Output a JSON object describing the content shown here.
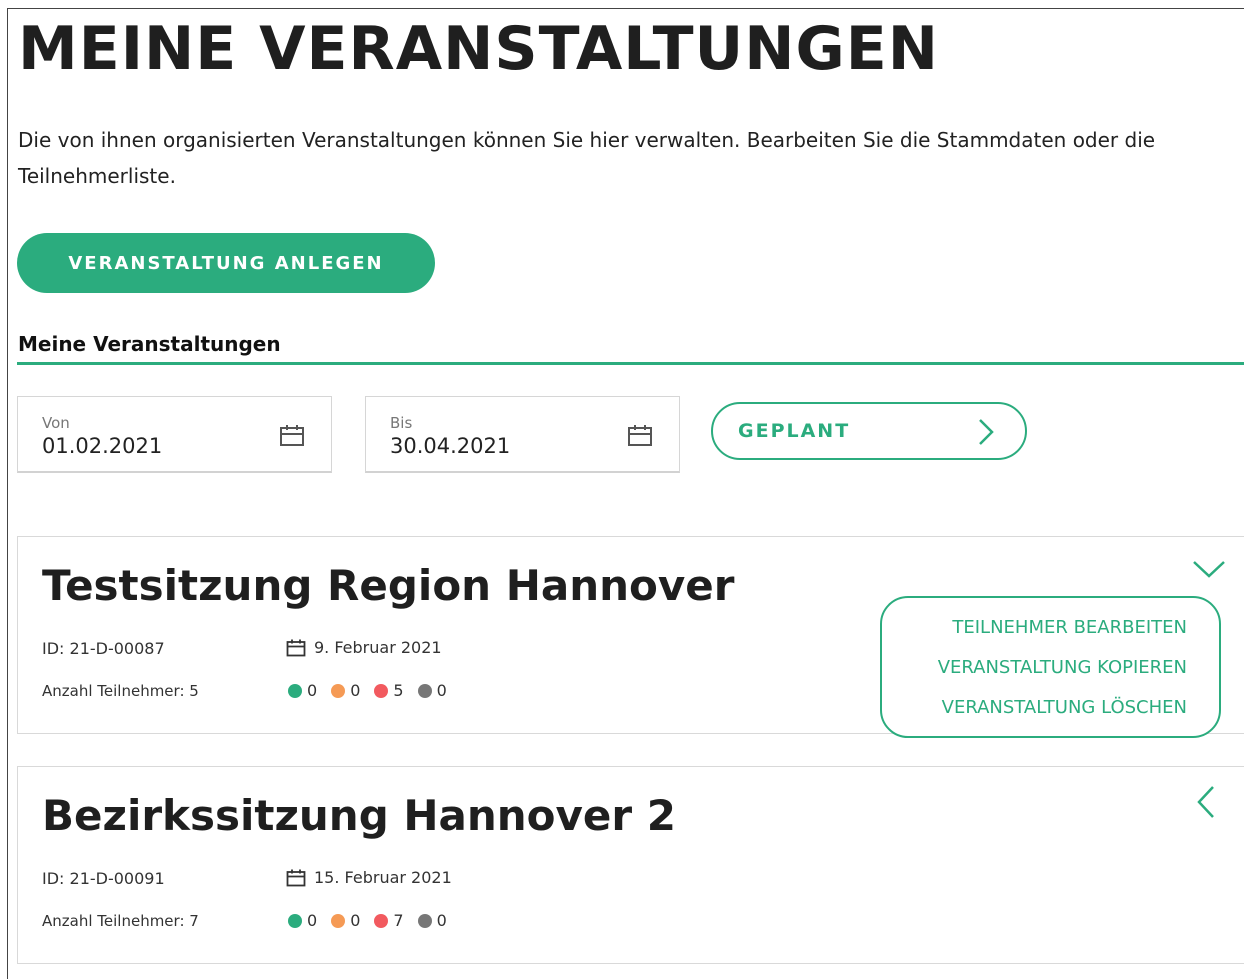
{
  "page": {
    "title": "MEINE VERANSTALTUNGEN",
    "intro": "Die von ihnen organisierten Veranstaltungen können Sie hier verwalten. Bearbeiten Sie die Stammdaten oder die Teilnehmerliste."
  },
  "create_button_label": "VERANSTALTUNG ANLEGEN",
  "list": {
    "heading": "Meine Veranstaltungen"
  },
  "filters": {
    "from": {
      "label": "Von",
      "value": "01.02.2021"
    },
    "to": {
      "label": "Bis",
      "value": "30.04.2021"
    },
    "status_label": "GEPLANT"
  },
  "status_colors": {
    "green": "#2bac7e",
    "orange": "#f59a55",
    "red": "#f25a5f",
    "grey": "#777777"
  },
  "events": [
    {
      "title": "Testsitzung Region Hannover",
      "id_text": "ID: 21-D-00087",
      "date": "9. Februar 2021",
      "participants_text": "Anzahl Teilnehmer: 5",
      "counts": {
        "green": "0",
        "orange": "0",
        "red": "5",
        "grey": "0"
      },
      "toggle_icon": "chevron-down-icon"
    },
    {
      "title": "Bezirkssitzung Hannover 2",
      "id_text": "ID: 21-D-00091",
      "date": "15. Februar 2021",
      "participants_text": "Anzahl Teilnehmer: 7",
      "counts": {
        "green": "0",
        "orange": "0",
        "red": "7",
        "grey": "0"
      },
      "toggle_icon": "chevron-left-icon"
    }
  ],
  "actions_menu": {
    "items": [
      "TEILNEHMER BEARBEITEN",
      "VERANSTALTUNG KOPIEREN",
      "VERANSTALTUNG LÖSCHEN"
    ]
  }
}
